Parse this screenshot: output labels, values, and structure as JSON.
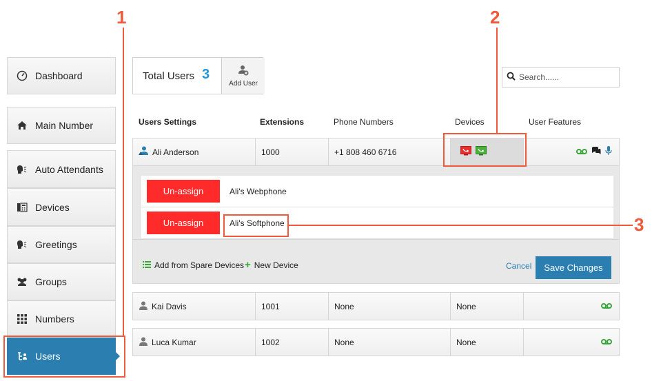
{
  "callouts": {
    "one": "1",
    "two": "2",
    "three": "3"
  },
  "sidebar": {
    "items": [
      {
        "label": "Dashboard",
        "icon": "gauge-icon"
      },
      {
        "label": "Main Number",
        "icon": "home-icon"
      },
      {
        "label": "Auto Attendants",
        "icon": "speaker-head-icon"
      },
      {
        "label": "Devices",
        "icon": "phone-icon"
      },
      {
        "label": "Greetings",
        "icon": "speaker-head-icon"
      },
      {
        "label": "Groups",
        "icon": "users-icon"
      },
      {
        "label": "Numbers",
        "icon": "grid-icon"
      },
      {
        "label": "Users",
        "icon": "user-tree-icon"
      }
    ],
    "active": "Users"
  },
  "header": {
    "total_label": "Total Users",
    "total_count": "3",
    "add_user_label": "Add User",
    "search_placeholder": "Search......"
  },
  "table": {
    "columns": [
      "Users Settings",
      "Extensions",
      "Phone Numbers",
      "Devices",
      "User Features"
    ],
    "rows": [
      {
        "name": "Ali Anderson",
        "extension": "1000",
        "phone": "+1 808 460 6716",
        "devices": ""
      },
      {
        "name": "Kai Davis",
        "extension": "1001",
        "phone": "None",
        "devices": "None"
      },
      {
        "name": "Luca Kumar",
        "extension": "1002",
        "phone": "None",
        "devices": "None"
      }
    ]
  },
  "device_panel": {
    "unassign_label": "Un-assign",
    "devices": [
      "Ali's Webphone",
      "Ali's Softphone"
    ],
    "add_spare_label": "Add from Spare Devices",
    "new_device_label": "New Device",
    "cancel_label": "Cancel",
    "save_label": "Save Changes"
  },
  "colors": {
    "accent": "#2a7fb0",
    "count": "#2196d8",
    "danger": "#ff2a2a",
    "green": "#3aa63a",
    "callout": "#f05a3a"
  }
}
